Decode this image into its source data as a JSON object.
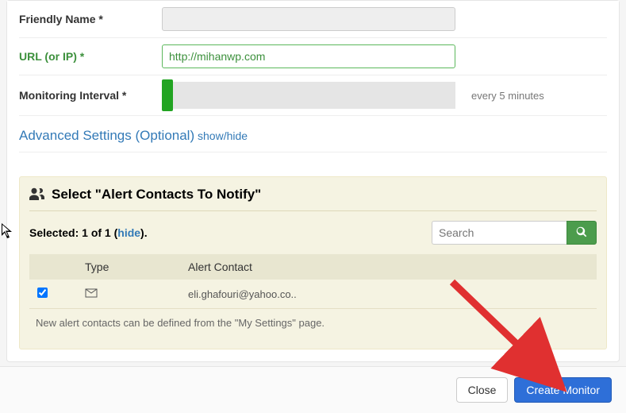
{
  "form": {
    "friendly_name_label": "Friendly Name",
    "friendly_name_value": "",
    "url_label": "URL (or IP)",
    "url_value": "http://mihanwp.com",
    "interval_label": "Monitoring Interval",
    "interval_display": "every 5 minutes",
    "advanced_label": "Advanced Settings (Optional)",
    "advanced_toggle": "show/hide",
    "required_star": "*"
  },
  "alerts": {
    "panel_title": "Select \"Alert Contacts To Notify\"",
    "selected_prefix": "Selected: 1 of 1 (",
    "hide_text": "hide",
    "selected_suffix": ").",
    "search_placeholder": "Search",
    "col_type": "Type",
    "col_contact": "Alert Contact",
    "rows": [
      {
        "checked": true,
        "type_icon": "envelope",
        "contact": "eli.ghafouri@yahoo.co.."
      }
    ],
    "help_text": "New alert contacts can be defined from the \"My Settings\" page."
  },
  "footer": {
    "close_label": "Close",
    "create_label": "Create Monitor"
  }
}
